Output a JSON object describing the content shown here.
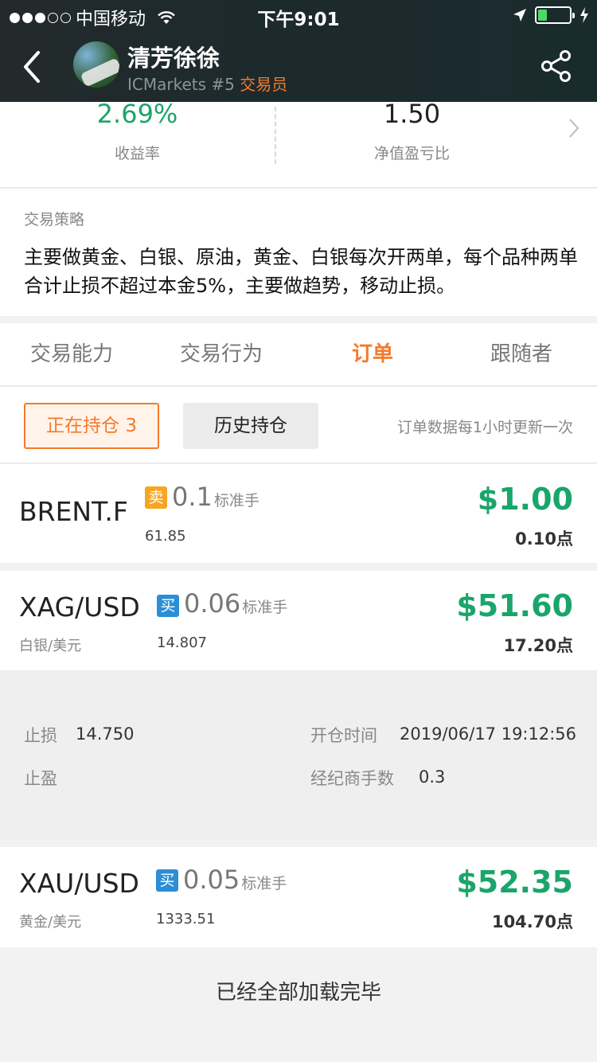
{
  "status_bar": {
    "carrier": "中国移动",
    "time": "下午9:01",
    "battery_level": 0.3
  },
  "header": {
    "trader_name": "清芳徐徐",
    "broker": "ICMarkets #5",
    "role": "交易员",
    "icons": {
      "back": "back-chevron-icon",
      "share": "share-icon"
    }
  },
  "stats": {
    "return_value": "2.69%",
    "return_label": "收益率",
    "ratio_value": "1.50",
    "ratio_label": "净值盈亏比"
  },
  "strategy": {
    "title": "交易策略",
    "text": "主要做黄金、白银、原油，黄金、白银每次开两单，每个品种两单合计止损不超过本金5%，主要做趋势，移动止损。"
  },
  "tabs": [
    {
      "label": "交易能力"
    },
    {
      "label": "交易行为"
    },
    {
      "label": "订单"
    },
    {
      "label": "跟随者"
    }
  ],
  "subbar": {
    "holding_label": "正在持仓 3",
    "history_label": "历史持仓",
    "note": "订单数据每1小时更新一次"
  },
  "orders": [
    {
      "symbol": "BRENT.F",
      "subtitle": "",
      "side": "卖",
      "lots": "0.1",
      "lot_unit": "标准手",
      "open_price": "61.85",
      "profit": "$1.00",
      "points": "0.10点"
    },
    {
      "symbol": "XAG/USD",
      "subtitle": "白银/美元",
      "side": "买",
      "lots": "0.06",
      "lot_unit": "标准手",
      "open_price": "14.807",
      "profit": "$51.60",
      "points": "17.20点"
    },
    {
      "symbol": "XAU/USD",
      "subtitle": "黄金/美元",
      "side": "买",
      "lots": "0.05",
      "lot_unit": "标准手",
      "open_price": "1333.51",
      "profit": "$52.35",
      "points": "104.70点"
    }
  ],
  "detail": {
    "stop_loss_label": "止损",
    "stop_loss_value": "14.750",
    "take_profit_label": "止盈",
    "open_time_label": "开仓时间",
    "open_time_value": "2019/06/17 19:12:56",
    "commission_label": "经纪商手数",
    "commission_value": "0.3"
  },
  "footer": {
    "message": "已经全部加载完毕"
  },
  "colors": {
    "accent": "#f47a2a",
    "profit": "#1aa56a",
    "sell": "#f6a623",
    "buy": "#2c8fd6",
    "header_bg": "#1d2a2d"
  }
}
